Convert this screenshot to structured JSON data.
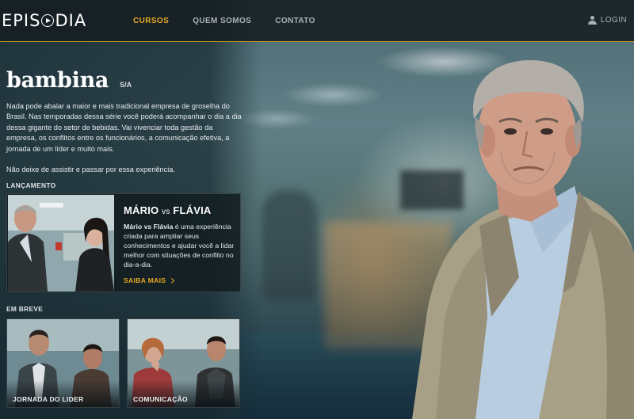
{
  "brand": {
    "logo_left": "EPIS",
    "logo_right": "DIA"
  },
  "nav": {
    "items": [
      {
        "label": "CURSOS",
        "active": true
      },
      {
        "label": "QUEM SOMOS",
        "active": false
      },
      {
        "label": "CONTATO",
        "active": false
      }
    ],
    "login_label": "LOGIN",
    "accent": "#e7a923"
  },
  "show": {
    "title": "bambina",
    "subtitle": "S/A",
    "description": [
      "Nada pode abalar a maior e mais tradicional empresa de groselha do Brasil. Nas temporadas dessa série você poderá acompanhar o dia a dia dessa gigante do setor de bebidas. Vai vivenciar toda gestão da empresa, os conflitos entre os funcionários, a comunicação efetiva, a jornada de um líder e muito mais.",
      "Não deixe de assistir e passar por essa experiência."
    ]
  },
  "launch": {
    "section_label": "LANÇAMENTO",
    "title_a": "MÁRIO",
    "title_vs": "vs",
    "title_b": "FLÁVIA",
    "text_bold": "Mário vs Flávia",
    "text_rest": " é uma experiência criada para ampliar seus conhecimentos e ajudar você a lidar melhor com situações de conflito no dia-a-dia.",
    "link_label": "SAIBA MAIS"
  },
  "upcoming": {
    "section_label": "EM BREVE",
    "cards": [
      {
        "label": "JORNADA DO LIDER"
      },
      {
        "label": "COMUNICAÇÃO"
      }
    ]
  }
}
